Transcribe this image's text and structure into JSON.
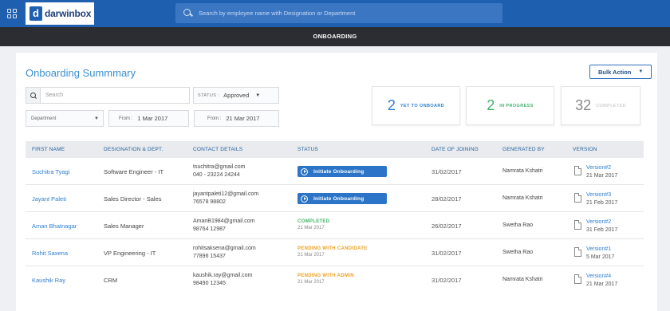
{
  "header": {
    "logo_letter": "d",
    "logo_text": "darwinbox",
    "search_placeholder": "Search by employee name with Designation or Department"
  },
  "subheader": {
    "title": "ONBOARDING"
  },
  "page": {
    "title": "Onboarding Summmary",
    "bulk_action_label": "Bulk Action"
  },
  "filters": {
    "search_placeholder": "Search",
    "status_label": "STATUS :",
    "status_value": "Approved",
    "department_placeholder": "Department",
    "from1_label": "From :",
    "from1_value": "1 Mar 2017",
    "from2_label": "From :",
    "from2_value": "21 Mar 2017"
  },
  "stats": [
    {
      "count": "2",
      "label": "YET TO ONBOARD",
      "color": "#2f7fcf"
    },
    {
      "count": "2",
      "label": "IN PROGRESS",
      "color": "#43b36b"
    },
    {
      "count": "32",
      "label": "COMPLETED",
      "color": "#888888"
    }
  ],
  "table": {
    "headers": [
      "FIRST NAME",
      "DESIGNATION & DEPT.",
      "CONTACT DETAILS",
      "STATUS",
      "DATE OF JOINING",
      "GENERATED BY",
      "VERSION"
    ],
    "initiate_label": "Initiate Onboarding",
    "rows": [
      {
        "name": "Suchitra Tyagi",
        "designation": "Software Engineer - IT",
        "email": "tsuchitra@gmail.com",
        "phone": "040 - 23224 24244",
        "status_type": "button",
        "date_of_joining": "31/02/2017",
        "generated_by": "Namrata Kshatri",
        "version": "Version#2",
        "version_date": "21 Mar 2017"
      },
      {
        "name": "Jayant Paleti",
        "designation": "Sales Director - Sales",
        "email": "jayantpaleti12@gmail.com",
        "phone": "76578 98802",
        "status_type": "button",
        "date_of_joining": "28/02/2017",
        "generated_by": "Namrata Kshatri",
        "version": "Version#3",
        "version_date": "21 Feb 2017"
      },
      {
        "name": "Aman Bhatnagar",
        "designation": "Sales Manager",
        "email": "AmanB1984@gmail.com",
        "phone": "98764 12987",
        "status_type": "text",
        "status_text": "COMPLETED",
        "status_color": "#43b36b",
        "status_date": "21 Mar 2017",
        "date_of_joining": "26/02/2017",
        "generated_by": "Swetha Rao",
        "version": "Version#2",
        "version_date": "31 Feb 2017"
      },
      {
        "name": "Rohit Saxena",
        "designation": "VP Engineering - IT",
        "email": "rohitsaksena@gmail.com",
        "phone": "77896 15437",
        "status_type": "text",
        "status_text": "PENDING WITH CANDIDATE",
        "status_color": "#f0a020",
        "status_date": "21 Mar 2017",
        "date_of_joining": "31/02/2017",
        "generated_by": "Swetha Rao",
        "version": "Version#1",
        "version_date": "5 Mar 2017"
      },
      {
        "name": "Kaushik Ray",
        "designation": "CRM",
        "email": "kaushik.ray@gmail.com",
        "phone": "98490 12345",
        "status_type": "text",
        "status_text": "PENDING WITH ADMIN",
        "status_color": "#f0a020",
        "status_date": "21 Mar 2017",
        "date_of_joining": "31/02/2017",
        "generated_by": "Namrata Kshatri",
        "version": "Version#4",
        "version_date": "21 Mar 2017"
      }
    ]
  }
}
